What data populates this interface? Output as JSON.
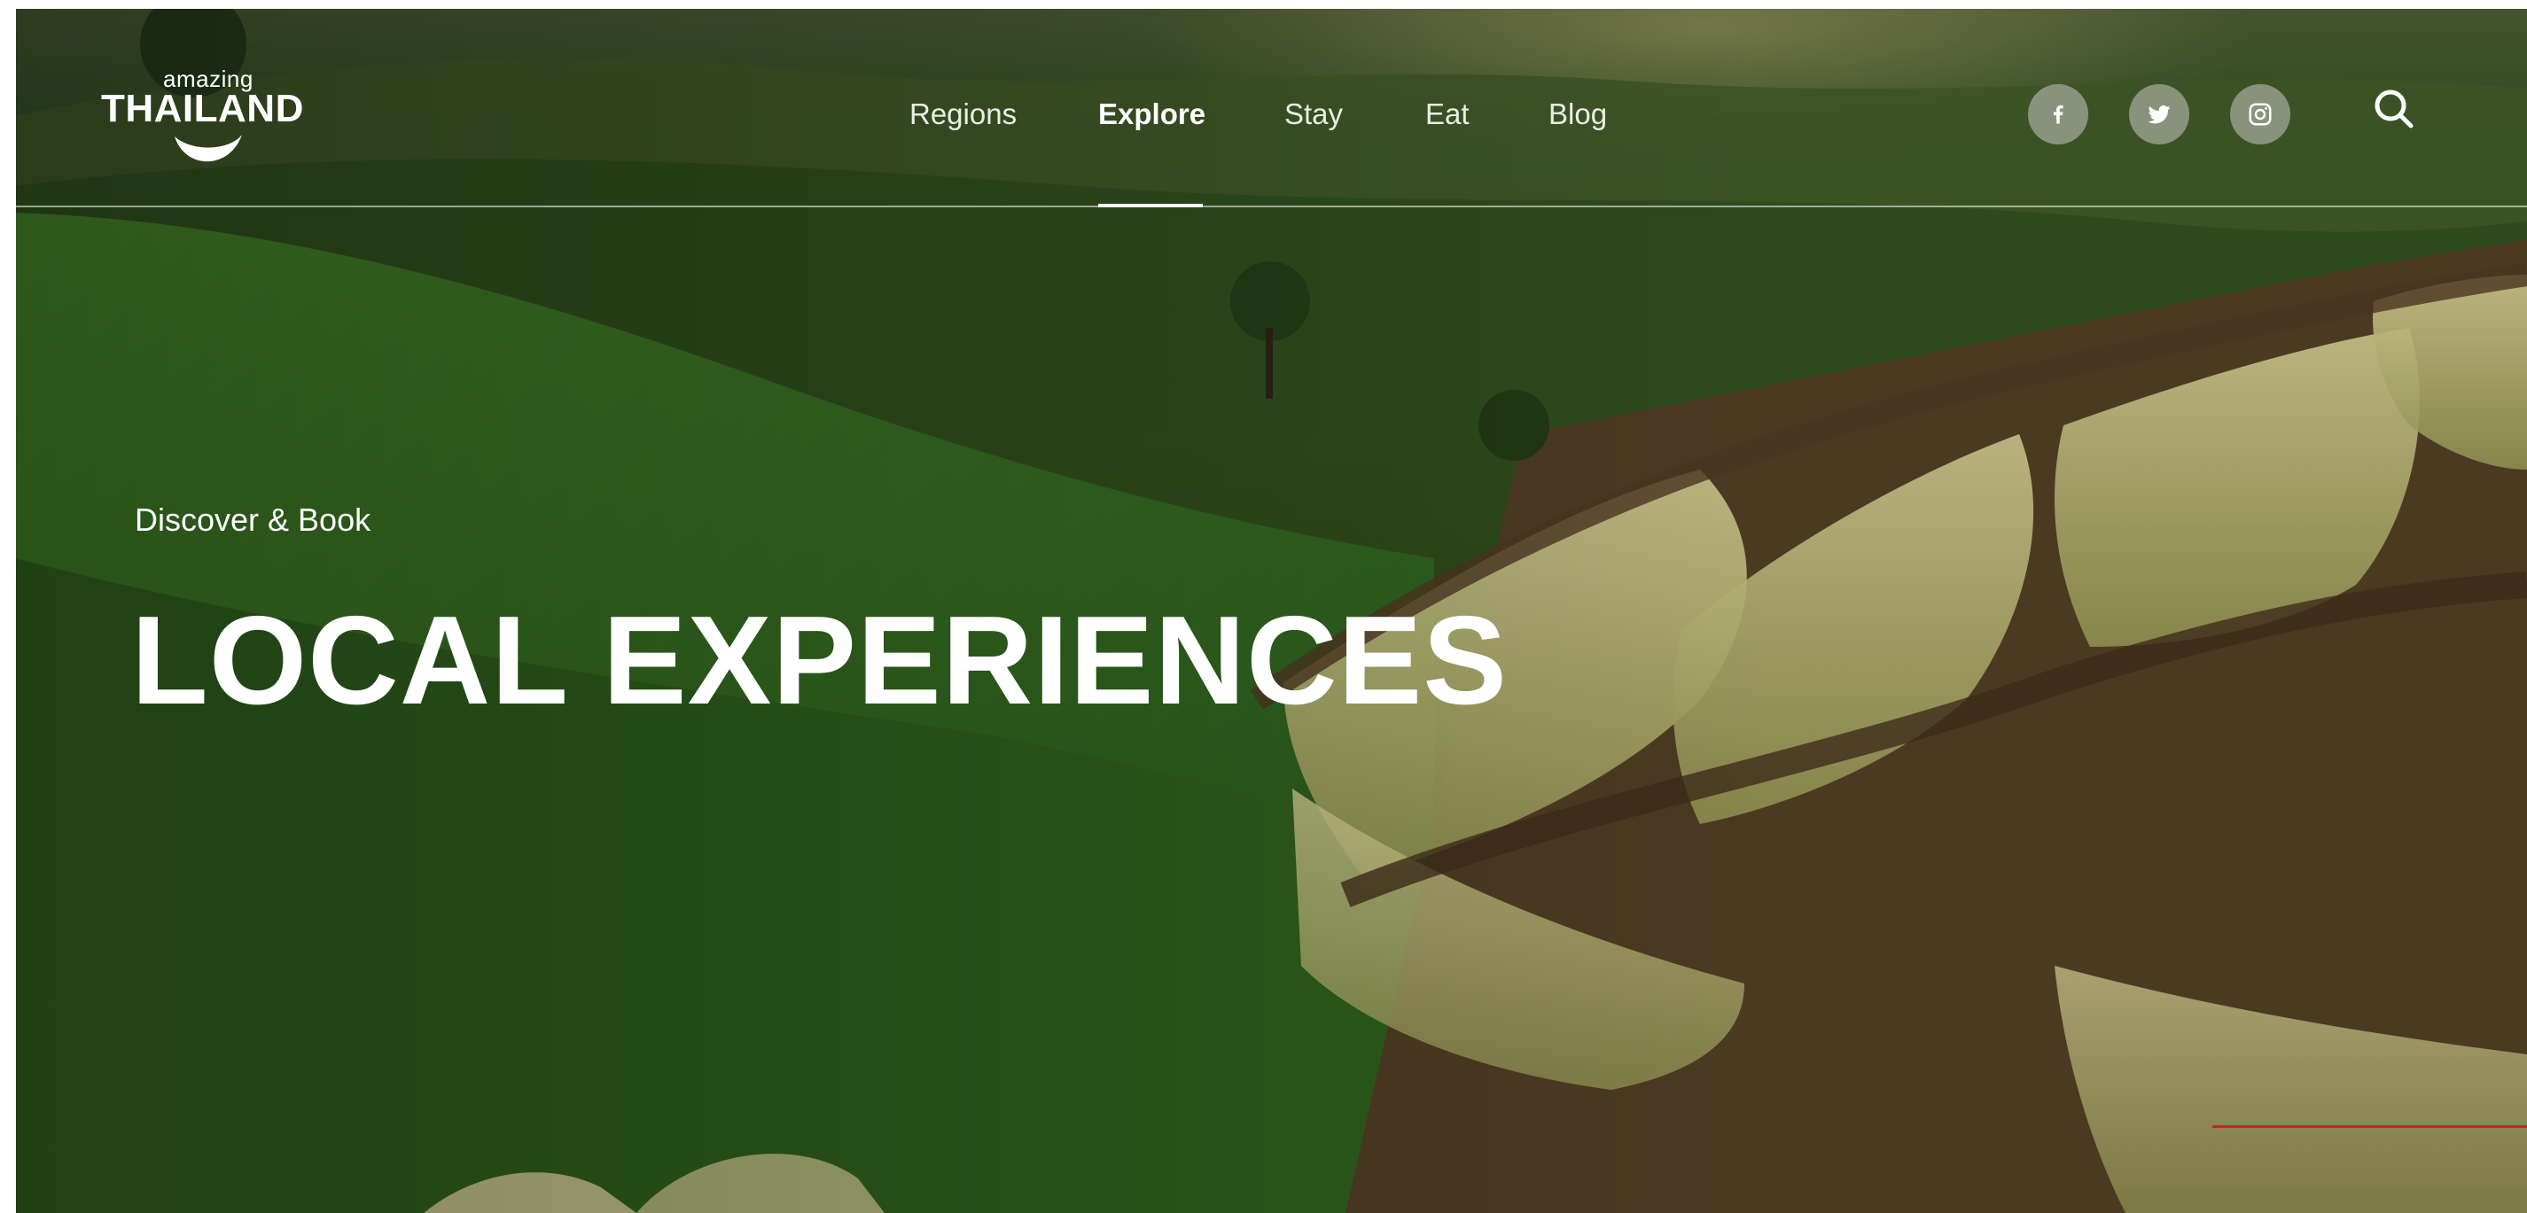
{
  "brand": {
    "logo_small": "amazing",
    "logo_main": "THAILAND"
  },
  "nav": {
    "items": [
      {
        "label": "Regions",
        "active": false
      },
      {
        "label": "Explore",
        "active": true
      },
      {
        "label": "Stay",
        "active": false
      },
      {
        "label": "Eat",
        "active": false
      },
      {
        "label": "Blog",
        "active": false
      }
    ]
  },
  "social": [
    {
      "icon": "facebook-icon"
    },
    {
      "icon": "twitter-icon"
    },
    {
      "icon": "instagram-icon"
    }
  ],
  "search": {
    "icon": "search-icon"
  },
  "hero": {
    "eyebrow": "Discover & Book",
    "headline": "LOCAL EXPERIENCES",
    "background": "green rice terraces landscape"
  },
  "colors": {
    "text": "#ffffff",
    "accent_line": "#d11f1f",
    "social_bg": "#c8c8c3"
  }
}
